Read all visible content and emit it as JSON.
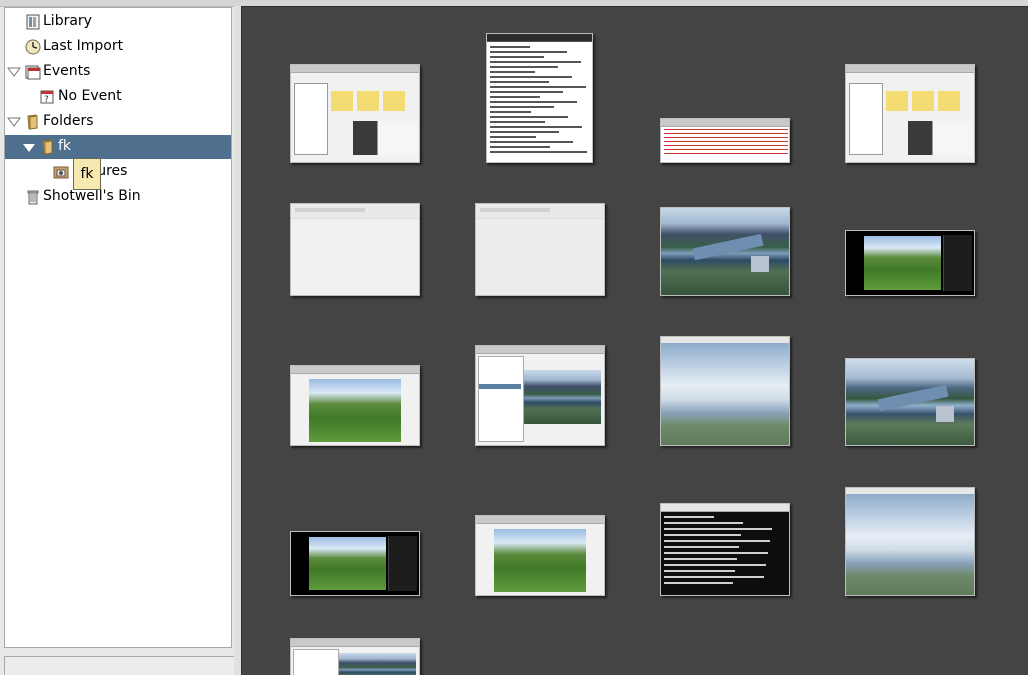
{
  "sidebar": {
    "items": [
      {
        "label": "Library",
        "icon": "library-icon"
      },
      {
        "label": "Last Import",
        "icon": "clock-icon"
      },
      {
        "label": "Events",
        "icon": "events-icon"
      },
      {
        "label": "No Event",
        "icon": "no-event-icon"
      },
      {
        "label": "Folders",
        "icon": "folder-icon"
      },
      {
        "label": "fk",
        "icon": "folder-icon",
        "selected": true
      },
      {
        "label": "Pictures",
        "icon": "pictures-folder-icon"
      },
      {
        "label": "Shotwell's Bin",
        "icon": "trash-icon"
      }
    ],
    "tooltip": "fk"
  },
  "viewer": {
    "background": "#444444",
    "thumbnails": [
      {
        "kind": "app-window",
        "name": "thumb-shotwell-window-1"
      },
      {
        "kind": "document",
        "name": "thumb-text-document"
      },
      {
        "kind": "spreadsheet",
        "name": "thumb-spreadsheet"
      },
      {
        "kind": "app-window",
        "name": "thumb-shotwell-window-2"
      },
      {
        "kind": "blank-window",
        "name": "thumb-blank-window-1"
      },
      {
        "kind": "blank-window",
        "name": "thumb-blank-window-2"
      },
      {
        "kind": "lake-photo",
        "name": "thumb-lake-aerial-1"
      },
      {
        "kind": "viewer-photo",
        "name": "thumb-hillside-viewer-1"
      },
      {
        "kind": "hill-window",
        "name": "thumb-hillside-window-1"
      },
      {
        "kind": "browser-window",
        "name": "thumb-image-browser"
      },
      {
        "kind": "sky-photo",
        "name": "thumb-sky-landscape-1"
      },
      {
        "kind": "lake-photo",
        "name": "thumb-lake-aerial-2"
      },
      {
        "kind": "viewer-photo",
        "name": "thumb-hillside-viewer-2"
      },
      {
        "kind": "hill-window",
        "name": "thumb-hillside-window-2"
      },
      {
        "kind": "terminal",
        "name": "thumb-terminal"
      },
      {
        "kind": "sky-photo",
        "name": "thumb-sky-landscape-2"
      },
      {
        "kind": "browser-window",
        "name": "thumb-image-browser-2"
      }
    ]
  }
}
